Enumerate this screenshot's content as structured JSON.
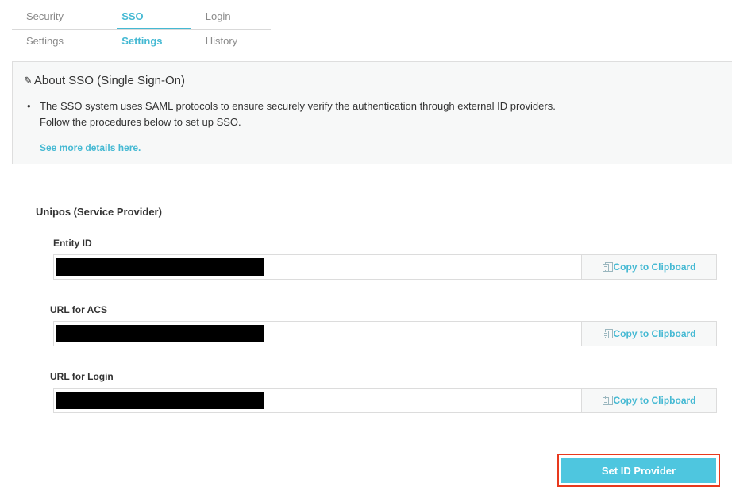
{
  "tabs": [
    {
      "label": "Security Settings"
    },
    {
      "label": "SSO Settings"
    },
    {
      "label": "Login History"
    }
  ],
  "about": {
    "title": "About SSO (Single Sign-On)",
    "line1": "The SSO system uses SAML protocols to ensure securely verify the authentication through external ID providers.",
    "line2": "Follow the procedures below to set up SSO.",
    "link": "See more details here."
  },
  "service_provider": {
    "title": "Unipos (Service Provider)",
    "fields": [
      {
        "label": "Entity ID",
        "copy_label": "Copy to Clipboard"
      },
      {
        "label": "URL for ACS",
        "copy_label": "Copy to Clipboard"
      },
      {
        "label": "URL for Login",
        "copy_label": "Copy to Clipboard"
      }
    ]
  },
  "actions": {
    "set_id_provider": "Set ID Provider"
  },
  "colors": {
    "accent": "#45b9d3",
    "button": "#4ec6df",
    "highlight": "#e8391d"
  }
}
